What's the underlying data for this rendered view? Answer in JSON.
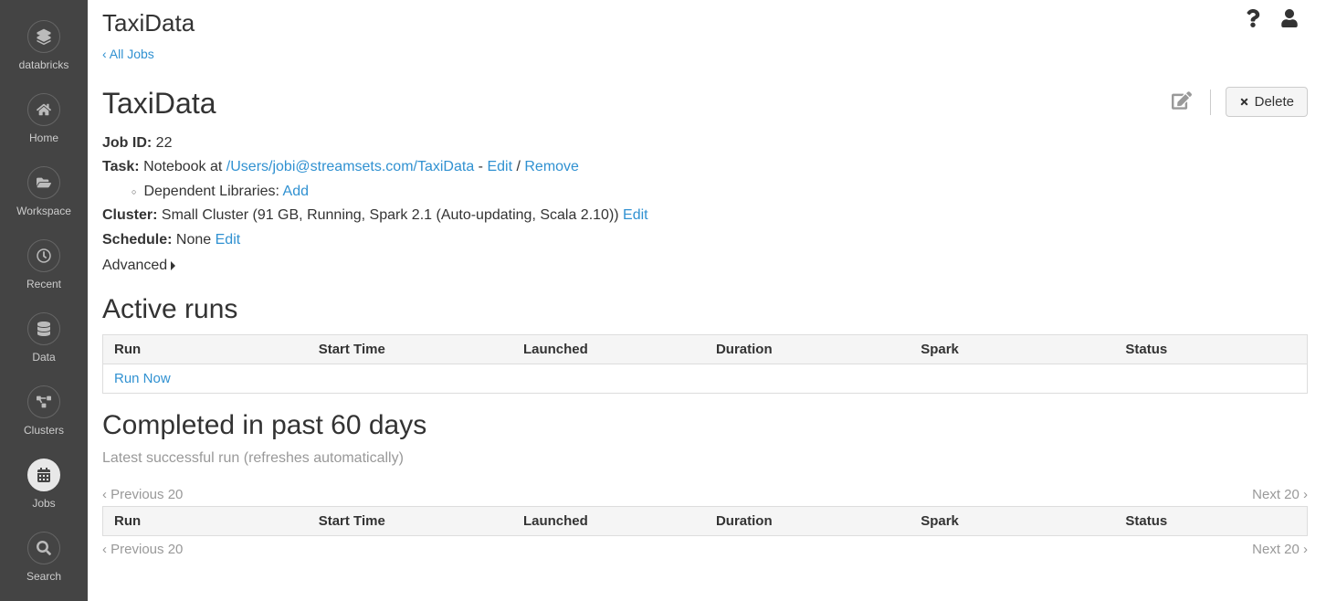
{
  "sidebar": {
    "brand": "databricks",
    "items": [
      {
        "label": "Home"
      },
      {
        "label": "Workspace"
      },
      {
        "label": "Recent"
      },
      {
        "label": "Data"
      },
      {
        "label": "Clusters"
      },
      {
        "label": "Jobs"
      },
      {
        "label": "Search"
      }
    ]
  },
  "page": {
    "breadcrumb_title": "TaxiData",
    "back_link": "‹ All Jobs"
  },
  "job": {
    "title": "TaxiData",
    "delete_label": "Delete",
    "id_label": "Job ID:",
    "id_value": "22",
    "task_label": "Task:",
    "task_prefix": "Notebook at ",
    "task_path": "/Users/jobi@streamsets.com/TaxiData",
    "task_sep1": " - ",
    "task_edit": "Edit",
    "task_sep2": " / ",
    "task_remove": "Remove",
    "dep_lib_label": "Dependent Libraries: ",
    "dep_lib_add": "Add",
    "cluster_label": "Cluster:",
    "cluster_value": "Small Cluster (91 GB, Running, Spark 2.1 (Auto-updating, Scala 2.10)) ",
    "cluster_edit": "Edit",
    "schedule_label": "Schedule:",
    "schedule_value": "None ",
    "schedule_edit": "Edit",
    "advanced_label": "Advanced"
  },
  "active_runs": {
    "title": "Active runs",
    "columns": {
      "run": "Run",
      "start": "Start Time",
      "launched": "Launched",
      "duration": "Duration",
      "spark": "Spark",
      "status": "Status"
    },
    "run_now": "Run Now"
  },
  "completed": {
    "title": "Completed in past 60 days",
    "refresh_note": "Latest successful run (refreshes automatically)",
    "prev": "‹ Previous 20",
    "next": "Next 20 ›",
    "columns": {
      "run": "Run",
      "start": "Start Time",
      "launched": "Launched",
      "duration": "Duration",
      "spark": "Spark",
      "status": "Status"
    }
  }
}
